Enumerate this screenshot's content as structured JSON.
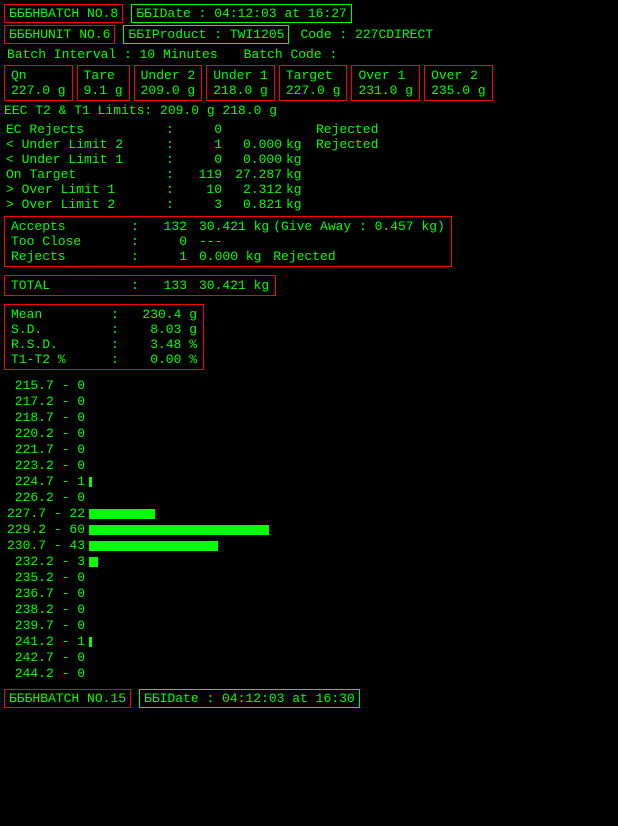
{
  "header1": {
    "batch_label": "БББНBATCH NO.8",
    "date_label": "ББІDate : 04:12:03 at 16:27"
  },
  "header2": {
    "unit_label": "БББНUNIT NO.6",
    "product_label": "ББІProduct : TWI1205",
    "code_label": "Code : 227CDIRECT"
  },
  "batch_interval": "Batch Interval : 10 Minutes",
  "batch_code": "Batch Code :",
  "fields": {
    "qn": {
      "label": "Qn",
      "value": "227.0 g"
    },
    "tare": {
      "label": "Tare",
      "value": "9.1 g"
    },
    "under2": {
      "label": "Under 2",
      "value": "209.0 g"
    },
    "under1": {
      "label": "Under 1",
      "value": "218.0 g"
    },
    "target": {
      "label": "Target",
      "value": "227.0 g"
    },
    "over1": {
      "label": "Over 1",
      "value": "231.0 g"
    },
    "over2": {
      "label": "Over 2",
      "value": "235.0 g"
    }
  },
  "eec": "EEC T2 & T1 Limits: 209.0 g   218.0 g",
  "stats": [
    {
      "label": "EC Rejects",
      "colon": ":",
      "value": "0",
      "kg": "",
      "kgunit": "",
      "status": "Rejected"
    },
    {
      "label": "< Under Limit 2",
      "colon": ":",
      "value": "1",
      "kg": "0.000",
      "kgunit": "kg",
      "status": "Rejected"
    },
    {
      "label": "< Under Limit 1",
      "colon": ":",
      "value": "0",
      "kg": "0.000",
      "kgunit": "kg",
      "status": ""
    },
    {
      "label": "On Target",
      "colon": ":",
      "value": "119",
      "kg": "27.287",
      "kgunit": "kg",
      "status": ""
    },
    {
      "label": "> Over Limit 1",
      "colon": ":",
      "value": "10",
      "kg": "2.312",
      "kgunit": "kg",
      "status": ""
    },
    {
      "label": "> Over Limit 2",
      "colon": ":",
      "value": "3",
      "kg": "0.821",
      "kgunit": "kg",
      "status": ""
    }
  ],
  "accepts_rejects": [
    {
      "label": "Accepts",
      "colon": ":",
      "value": "132",
      "kg": "30.421 kg",
      "extra": "(Give Away : 0.457  kg)"
    },
    {
      "label": "Too Close",
      "colon": ":",
      "value": "0",
      "kg": "---",
      "extra": ""
    },
    {
      "label": "Rejects",
      "colon": ":",
      "value": "1",
      "kg": "0.000 kg",
      "extra": "Rejected"
    }
  ],
  "total": {
    "label": "TOTAL",
    "colon": ":",
    "value": "133",
    "kg": "30.421 kg"
  },
  "metrics": [
    {
      "label": "Mean",
      "colon": ":",
      "value": "230.4 g"
    },
    {
      "label": "S.D.",
      "colon": ":",
      "value": "8.03 g"
    },
    {
      "label": "R.S.D.",
      "colon": ":",
      "value": "3.48 %"
    },
    {
      "label": "T1-T2 %",
      "colon": ":",
      "value": "0.00 %"
    }
  ],
  "histogram": [
    {
      "range": "215.7 - 0",
      "count": 0
    },
    {
      "range": "217.2 - 0",
      "count": 0
    },
    {
      "range": "218.7 - 0",
      "count": 0
    },
    {
      "range": "220.2 - 0",
      "count": 0
    },
    {
      "range": "221.7 - 0",
      "count": 0
    },
    {
      "range": "223.2 - 0",
      "count": 0
    },
    {
      "range": "224.7 - 1",
      "count": 1
    },
    {
      "range": "226.2 - 0",
      "count": 0
    },
    {
      "range": "227.7 - 22",
      "count": 22
    },
    {
      "range": "229.2 - 60",
      "count": 60
    },
    {
      "range": "230.7 - 43",
      "count": 43
    },
    {
      "range": "232.2 - 3",
      "count": 3
    },
    {
      "range": "235.2 - 0",
      "count": 0
    },
    {
      "range": "236.7 - 0",
      "count": 0
    },
    {
      "range": "238.2 - 0",
      "count": 0
    },
    {
      "range": "239.7 - 0",
      "count": 0
    },
    {
      "range": "241.2 - 1",
      "count": 1
    },
    {
      "range": "242.7 - 0",
      "count": 0
    },
    {
      "range": "244.2 - 0",
      "count": 0
    }
  ],
  "footer": {
    "batch_label": "БББНBATCH NO.15",
    "date_label": "ББІDate : 04:12:03 at 16:30"
  }
}
